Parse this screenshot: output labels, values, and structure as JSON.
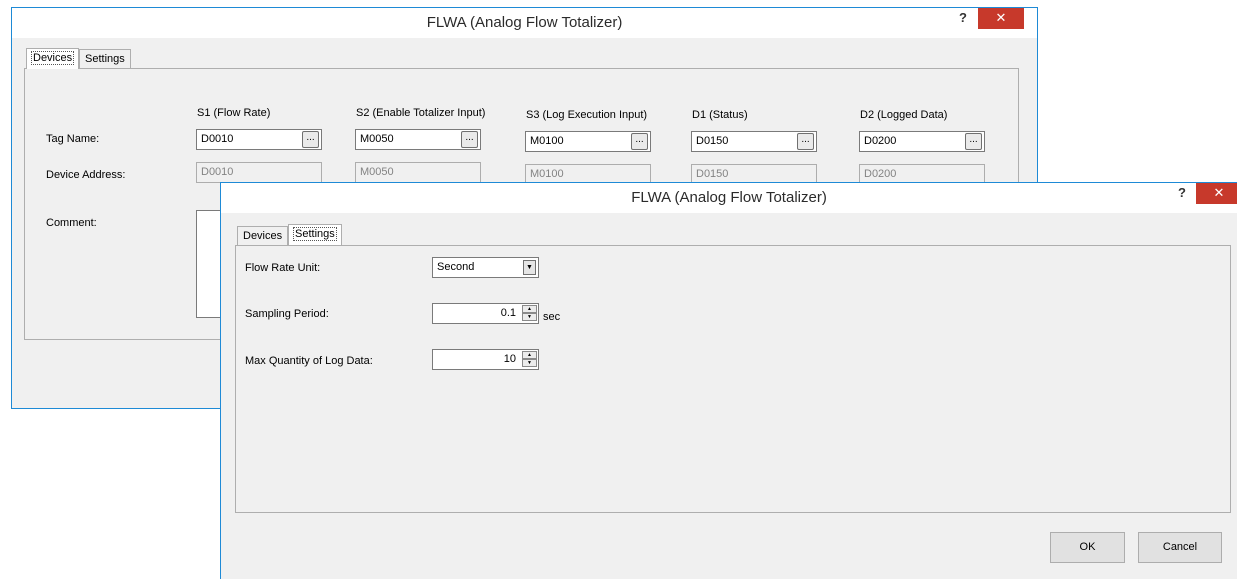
{
  "back": {
    "title": "FLWA (Analog Flow Totalizer)",
    "help": "?",
    "close": "✕",
    "tabs": [
      "Devices",
      "Settings"
    ],
    "row_labels": {
      "tag_name": "Tag Name:",
      "device_address": "Device Address:",
      "comment": "Comment:"
    },
    "columns": [
      {
        "header": "S1 (Flow Rate)",
        "tag": "D0010",
        "address": "D0010"
      },
      {
        "header": "S2 (Enable Totalizer Input)",
        "tag": "M0050",
        "address": "M0050"
      },
      {
        "header": "S3 (Log Execution Input)",
        "tag": "M0100",
        "address": "M0100"
      },
      {
        "header": "D1 (Status)",
        "tag": "D0150",
        "address": "D0150"
      },
      {
        "header": "D2 (Logged Data)",
        "tag": "D0200",
        "address": "D0200"
      }
    ],
    "browse": "..."
  },
  "front": {
    "title": "FLWA (Analog Flow Totalizer)",
    "help": "?",
    "close": "✕",
    "tabs": [
      "Devices",
      "Settings"
    ],
    "flow_rate_unit": {
      "label": "Flow Rate Unit:",
      "value": "Second"
    },
    "sampling_period": {
      "label": "Sampling Period:",
      "value": "0.1",
      "unit": "sec"
    },
    "max_log": {
      "label": "Max Quantity of Log Data:",
      "value": "10"
    },
    "ok": "OK",
    "cancel": "Cancel"
  },
  "colors": {
    "accent": "#1e8ad6",
    "close": "#c7392b"
  }
}
